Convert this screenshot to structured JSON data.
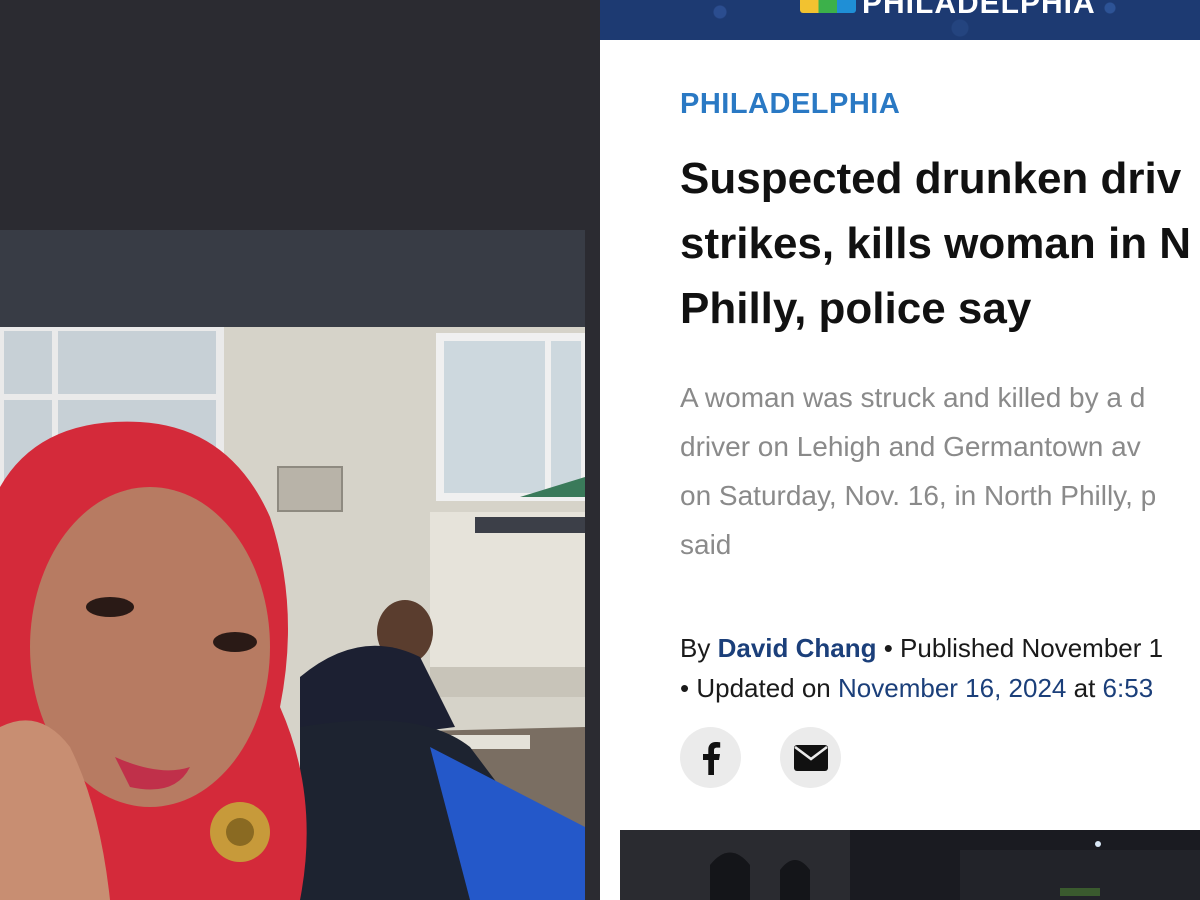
{
  "article": {
    "masthead_text": "PHILADELPHIA",
    "section": "PHILADELPHIA",
    "headline_lines": [
      "Suspected drunken driv",
      "strikes, kills woman in N",
      "Philly, police say"
    ],
    "summary_lines": [
      "A woman was struck and killed by a d",
      "driver on Lehigh and Germantown av",
      "on Saturday, Nov. 16, in North Philly, p",
      "said"
    ],
    "byline": {
      "by_prefix": "By",
      "author": "David Chang",
      "published_text": "• Published November 1",
      "updated_prefix": "• Updated on",
      "updated_date": "November 16, 2024",
      "at_text": "at",
      "updated_time": "6:53"
    },
    "share_buttons": [
      {
        "icon": "facebook-icon"
      },
      {
        "icon": "mail-icon"
      }
    ]
  },
  "colors": {
    "section": "#2a79c4",
    "author_link": "#1b3f7a",
    "summary_text": "#8a8a8a",
    "masthead_bg": "#1d3a72",
    "left_dark_bg": "#2b2b31",
    "left_bar_bg": "#383c45"
  }
}
